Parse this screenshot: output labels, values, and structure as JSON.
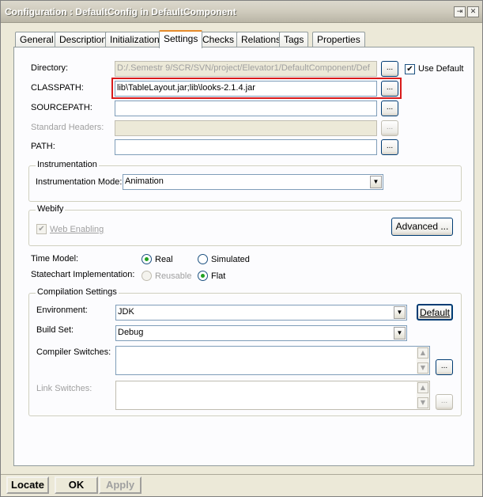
{
  "window": {
    "title": "Configuration : DefaultConfig in DefaultComponent"
  },
  "tabs": [
    {
      "label": "General"
    },
    {
      "label": "Description"
    },
    {
      "label": "Initialization"
    },
    {
      "label": "Settings"
    },
    {
      "label": "Checks"
    },
    {
      "label": "Relations"
    },
    {
      "label": "Tags"
    },
    {
      "label": "Properties"
    }
  ],
  "settings": {
    "directory": {
      "label": "Directory:",
      "value": "D:/.Semestr 9/SCR/SVN/project/Elevator1/DefaultComponent/Def",
      "browse": "...",
      "use_default": "Use Default"
    },
    "classpath": {
      "label": "CLASSPATH:",
      "value": "lib\\TableLayout.jar;lib\\looks-2.1.4.jar",
      "browse": "..."
    },
    "sourcepath": {
      "label": "SOURCEPATH:",
      "value": "",
      "browse": "..."
    },
    "standard_headers": {
      "label": "Standard Headers:",
      "value": "",
      "browse": "..."
    },
    "path": {
      "label": "PATH:",
      "value": "",
      "browse": "..."
    }
  },
  "instrumentation": {
    "group": "Instrumentation",
    "mode_label": "Instrumentation Mode:",
    "mode_value": "Animation"
  },
  "webify": {
    "group": "Webify",
    "enabling": "Web Enabling",
    "advanced": "Advanced ..."
  },
  "time_model": {
    "label": "Time Model:",
    "real": "Real",
    "simulated": "Simulated"
  },
  "statechart": {
    "label": "Statechart Implementation:",
    "reusable": "Reusable",
    "flat": "Flat"
  },
  "compilation": {
    "group": "Compilation Settings",
    "environment_label": "Environment:",
    "environment_value": "JDK",
    "default_button": "Default",
    "build_set_label": "Build Set:",
    "build_set_value": "Debug",
    "compiler_switches_label": "Compiler Switches:",
    "link_switches_label": "Link Switches:",
    "browse": "..."
  },
  "bottom": {
    "locate": "Locate",
    "ok": "OK",
    "apply": "Apply"
  }
}
